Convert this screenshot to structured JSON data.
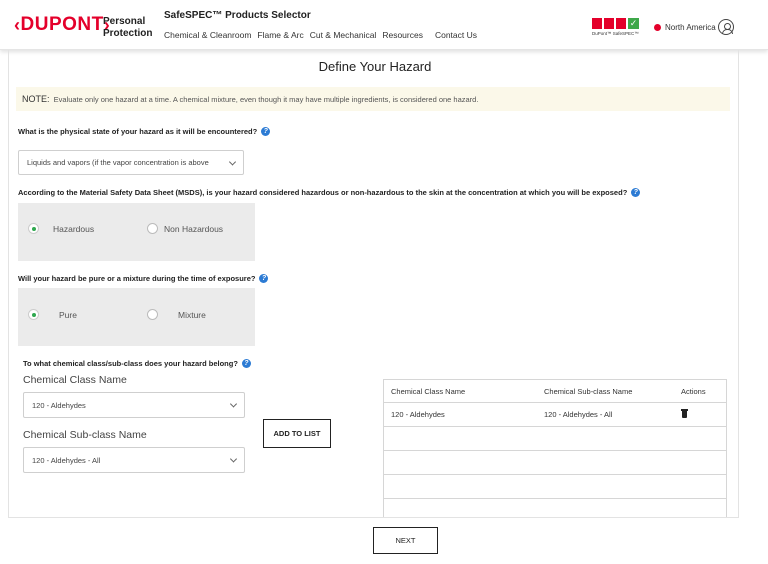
{
  "header": {
    "logo": "DUPONT",
    "brand_line1": "Personal",
    "brand_line2": "Protection",
    "app_title": "SafeSPEC™ Products Selector",
    "nav": [
      "Chemical & Cleanroom",
      "Flame & Arc",
      "Cut & Mechanical",
      "Resources",
      "Contact Us"
    ],
    "safespec_caption": "DuPont™ SafeSPEC™",
    "region": "North America"
  },
  "page_title": "Define Your Hazard",
  "note": {
    "label": "NOTE:",
    "text": "Evaluate only one hazard at a time. A chemical mixture, even though it may have multiple ingredients, is considered one hazard."
  },
  "q1": {
    "question": "What is the physical state of your hazard as it will be encountered?",
    "selected": "Liquids and vapors (if the vapor concentration is above"
  },
  "q2": {
    "question": "According to the Material Safety Data Sheet (MSDS), is your hazard considered hazardous or non-hazardous to the skin at the concentration at which you will be exposed?",
    "options": [
      "Hazardous",
      "Non Hazardous"
    ],
    "selected": "Hazardous"
  },
  "q3": {
    "question": "Will your hazard be pure or a mixture during the time of exposure?",
    "options": [
      "Pure",
      "Mixture"
    ],
    "selected": "Pure"
  },
  "q4": {
    "question": "To what chemical class/sub-class does your hazard belong?",
    "class_label": "Chemical Class Name",
    "class_selected": "120 - Aldehydes",
    "subclass_label": "Chemical Sub-class Name",
    "subclass_selected": "120 - Aldehydes - All",
    "add_button": "ADD TO LIST"
  },
  "table": {
    "columns": [
      "Chemical Class Name",
      "Chemical Sub-class Name",
      "Actions"
    ],
    "rows": [
      {
        "class": "120 - Aldehydes",
        "subclass": "120 - Aldehydes - All",
        "action_icon": "trash-icon"
      }
    ]
  },
  "next_button": "NEXT",
  "colors": {
    "brand_red": "#e4002b",
    "radio_selected": "#2fa84f",
    "help_blue": "#2c7bd4",
    "note_bg": "#fbf8e9"
  }
}
